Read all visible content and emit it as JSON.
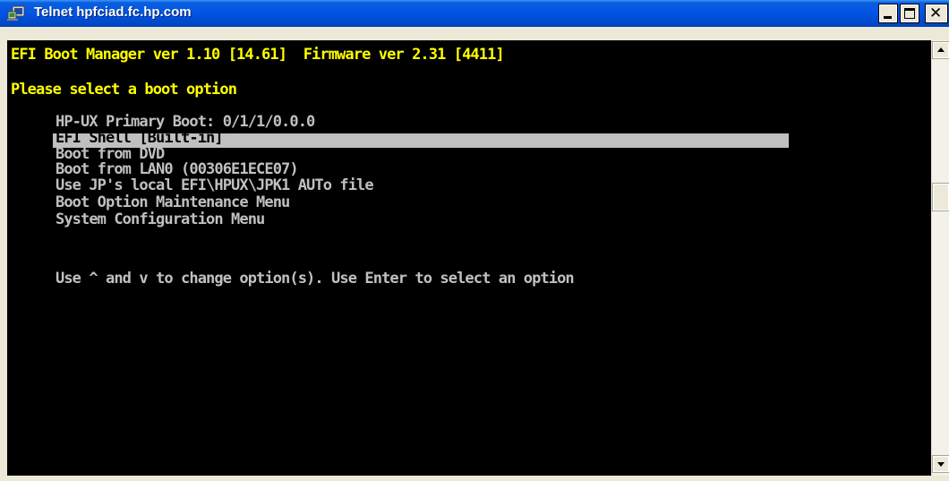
{
  "window": {
    "title": "Telnet hpfciad.fc.hp.com",
    "icon": "telnet-icon"
  },
  "console": {
    "header_line": "EFI Boot Manager ver 1.10 [14.61]  Firmware ver 2.31 [4411]",
    "prompt": "Please select a boot option",
    "options": [
      "HP-UX Primary Boot: 0/1/1/0.0.0",
      "EFI Shell [Built-in]",
      "Boot from DVD",
      "Boot from LAN0 (00306E1ECE07)",
      "Use JP's local EFI\\HPUX\\JPK1 AUTo file",
      "Boot Option Maintenance Menu",
      "System Configuration Menu"
    ],
    "selected_option": "EFI Shell [Built-in]",
    "help_text": "Use ^ and v to change option(s). Use Enter to select an option"
  },
  "colors": {
    "console_bg": "#000000",
    "console_text": "#c0c0c0",
    "header_text": "#ffff00",
    "selection_bg": "#c0c0c0",
    "titlebar": "#0054e3"
  }
}
